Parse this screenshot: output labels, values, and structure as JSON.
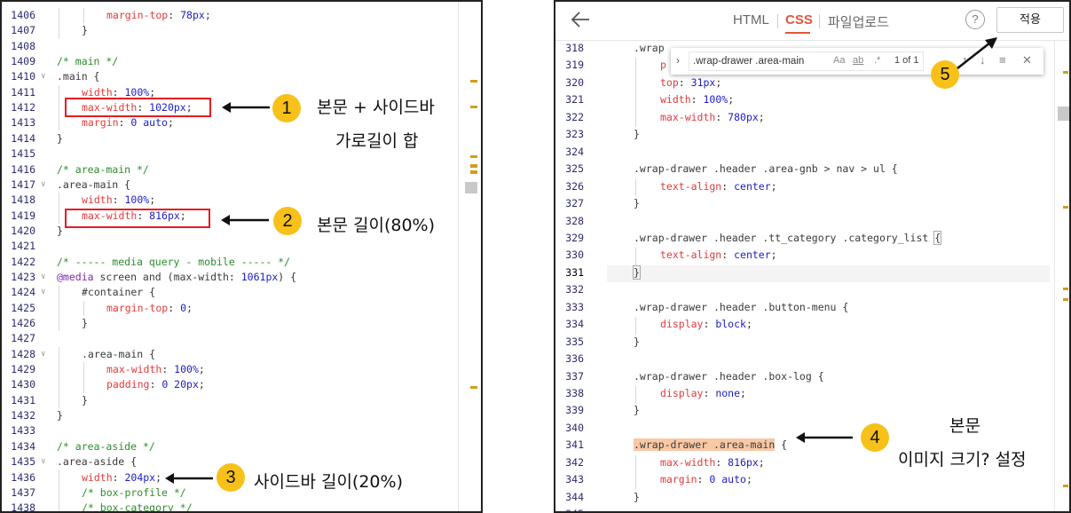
{
  "left_editor": {
    "lines": [
      {
        "n": "1406",
        "indent": 2,
        "fold": "",
        "tokens": [
          [
            "prop",
            "margin-top"
          ],
          [
            "punc",
            ": "
          ],
          [
            "val",
            "78px"
          ],
          [
            "punc",
            ";"
          ]
        ]
      },
      {
        "n": "1407",
        "indent": 1,
        "fold": "",
        "tokens": [
          [
            "punc",
            "}"
          ]
        ]
      },
      {
        "n": "1408",
        "indent": 0,
        "fold": "",
        "tokens": []
      },
      {
        "n": "1409",
        "indent": 0,
        "fold": "",
        "tokens": [
          [
            "cmt",
            "/* main */"
          ]
        ]
      },
      {
        "n": "1410",
        "indent": 0,
        "fold": "∨",
        "tokens": [
          [
            "sel",
            ".main "
          ],
          [
            "punc",
            "{"
          ]
        ]
      },
      {
        "n": "1411",
        "indent": 1,
        "fold": "",
        "tokens": [
          [
            "prop",
            "width"
          ],
          [
            "punc",
            ": "
          ],
          [
            "val",
            "100%"
          ],
          [
            "punc",
            ";"
          ]
        ]
      },
      {
        "n": "1412",
        "indent": 1,
        "fold": "",
        "tokens": [
          [
            "prop",
            "max-width"
          ],
          [
            "punc",
            ": "
          ],
          [
            "val",
            "1020px"
          ],
          [
            "punc",
            ";"
          ]
        ]
      },
      {
        "n": "1413",
        "indent": 1,
        "fold": "",
        "tokens": [
          [
            "prop",
            "margin"
          ],
          [
            "punc",
            ": "
          ],
          [
            "val",
            "0 auto"
          ],
          [
            "punc",
            ";"
          ]
        ]
      },
      {
        "n": "1414",
        "indent": 0,
        "fold": "",
        "tokens": [
          [
            "punc",
            "}"
          ]
        ]
      },
      {
        "n": "1415",
        "indent": 0,
        "fold": "",
        "tokens": []
      },
      {
        "n": "1416",
        "indent": 0,
        "fold": "",
        "tokens": [
          [
            "cmt",
            "/* area-main */"
          ]
        ]
      },
      {
        "n": "1417",
        "indent": 0,
        "fold": "∨",
        "tokens": [
          [
            "sel",
            ".area-main "
          ],
          [
            "punc",
            "{"
          ]
        ]
      },
      {
        "n": "1418",
        "indent": 1,
        "fold": "",
        "tokens": [
          [
            "prop",
            "width"
          ],
          [
            "punc",
            ": "
          ],
          [
            "val",
            "100%"
          ],
          [
            "punc",
            ";"
          ]
        ]
      },
      {
        "n": "1419",
        "indent": 1,
        "fold": "",
        "tokens": [
          [
            "prop",
            "max-width"
          ],
          [
            "punc",
            ": "
          ],
          [
            "val",
            "816px"
          ],
          [
            "punc",
            ";"
          ]
        ]
      },
      {
        "n": "1420",
        "indent": 0,
        "fold": "",
        "tokens": [
          [
            "punc",
            "}"
          ]
        ]
      },
      {
        "n": "1421",
        "indent": 0,
        "fold": "",
        "tokens": []
      },
      {
        "n": "1422",
        "indent": 0,
        "fold": "",
        "tokens": [
          [
            "cmt",
            "/* ----- media query - mobile ----- */"
          ]
        ]
      },
      {
        "n": "1423",
        "indent": 0,
        "fold": "∨",
        "tokens": [
          [
            "kw",
            "@media "
          ],
          [
            "sel",
            "screen and "
          ],
          [
            "punc",
            "("
          ],
          [
            "sel",
            "max-width"
          ],
          [
            "punc",
            ": "
          ],
          [
            "val",
            "1061px"
          ],
          [
            "punc",
            ") {"
          ]
        ]
      },
      {
        "n": "1424",
        "indent": 1,
        "fold": "∨",
        "tokens": [
          [
            "sel",
            "#container "
          ],
          [
            "punc",
            "{"
          ]
        ]
      },
      {
        "n": "1425",
        "indent": 2,
        "fold": "",
        "tokens": [
          [
            "prop",
            "margin-top"
          ],
          [
            "punc",
            ": "
          ],
          [
            "val",
            "0"
          ],
          [
            "punc",
            ";"
          ]
        ]
      },
      {
        "n": "1426",
        "indent": 1,
        "fold": "",
        "tokens": [
          [
            "punc",
            "}"
          ]
        ]
      },
      {
        "n": "1427",
        "indent": 0,
        "fold": "",
        "tokens": []
      },
      {
        "n": "1428",
        "indent": 1,
        "fold": "∨",
        "tokens": [
          [
            "sel",
            ".area-main "
          ],
          [
            "punc",
            "{"
          ]
        ]
      },
      {
        "n": "1429",
        "indent": 2,
        "fold": "",
        "tokens": [
          [
            "prop",
            "max-width"
          ],
          [
            "punc",
            ": "
          ],
          [
            "val",
            "100%"
          ],
          [
            "punc",
            ";"
          ]
        ]
      },
      {
        "n": "1430",
        "indent": 2,
        "fold": "",
        "tokens": [
          [
            "prop",
            "padding"
          ],
          [
            "punc",
            ": "
          ],
          [
            "val",
            "0 20px"
          ],
          [
            "punc",
            ";"
          ]
        ]
      },
      {
        "n": "1431",
        "indent": 1,
        "fold": "",
        "tokens": [
          [
            "punc",
            "}"
          ]
        ]
      },
      {
        "n": "1432",
        "indent": 0,
        "fold": "",
        "tokens": [
          [
            "punc",
            "}"
          ]
        ]
      },
      {
        "n": "1433",
        "indent": 0,
        "fold": "",
        "tokens": []
      },
      {
        "n": "1434",
        "indent": 0,
        "fold": "",
        "tokens": [
          [
            "cmt",
            "/* area-aside */"
          ]
        ]
      },
      {
        "n": "1435",
        "indent": 0,
        "fold": "∨",
        "tokens": [
          [
            "sel",
            ".area-aside "
          ],
          [
            "punc",
            "{"
          ]
        ]
      },
      {
        "n": "1436",
        "indent": 1,
        "fold": "",
        "tokens": [
          [
            "prop",
            "width"
          ],
          [
            "punc",
            ": "
          ],
          [
            "val",
            "204px"
          ],
          [
            "punc",
            ";"
          ]
        ]
      },
      {
        "n": "1437",
        "indent": 1,
        "fold": "",
        "tokens": [
          [
            "cmt",
            "/* box-profile */"
          ]
        ]
      },
      {
        "n": "1438",
        "indent": 1,
        "fold": "",
        "tokens": [
          [
            "cmt",
            "/* box-category */"
          ]
        ]
      }
    ]
  },
  "right_editor": {
    "tabs": {
      "html": "HTML",
      "css": "CSS",
      "file_upload": "파일업로드"
    },
    "help": "?",
    "apply": "적용",
    "find": {
      "query": ".wrap-drawer .area-main",
      "match_case": "Aa",
      "whole_word": "ab",
      "regex": ".*",
      "count": "1 of 1",
      "prev": "↑",
      "next": "↓",
      "in_selection": "≡",
      "close": "✕",
      "toggle": "›"
    },
    "lines": [
      {
        "n": "318",
        "indent": 0,
        "tokens": [
          [
            "sel",
            ".wrap"
          ]
        ]
      },
      {
        "n": "319",
        "indent": 1,
        "tokens": [
          [
            "prop",
            "p"
          ]
        ]
      },
      {
        "n": "320",
        "indent": 1,
        "tokens": [
          [
            "prop",
            "top"
          ],
          [
            "punc",
            ": "
          ],
          [
            "val",
            "31px"
          ],
          [
            "punc",
            ";"
          ]
        ]
      },
      {
        "n": "321",
        "indent": 1,
        "tokens": [
          [
            "prop",
            "width"
          ],
          [
            "punc",
            ": "
          ],
          [
            "val",
            "100%"
          ],
          [
            "punc",
            ";"
          ]
        ]
      },
      {
        "n": "322",
        "indent": 1,
        "tokens": [
          [
            "prop",
            "max-width"
          ],
          [
            "punc",
            ": "
          ],
          [
            "val",
            "780px"
          ],
          [
            "punc",
            ";"
          ]
        ]
      },
      {
        "n": "323",
        "indent": 0,
        "tokens": [
          [
            "punc",
            "}"
          ]
        ]
      },
      {
        "n": "324",
        "indent": 0,
        "tokens": []
      },
      {
        "n": "325",
        "indent": 0,
        "tokens": [
          [
            "sel",
            ".wrap-drawer .header .area-gnb > nav > ul "
          ],
          [
            "punc",
            "{"
          ]
        ]
      },
      {
        "n": "326",
        "indent": 1,
        "tokens": [
          [
            "prop",
            "text-align"
          ],
          [
            "punc",
            ": "
          ],
          [
            "val",
            "center"
          ],
          [
            "punc",
            ";"
          ]
        ]
      },
      {
        "n": "327",
        "indent": 0,
        "tokens": [
          [
            "punc",
            "}"
          ]
        ]
      },
      {
        "n": "328",
        "indent": 0,
        "tokens": []
      },
      {
        "n": "329",
        "indent": 0,
        "tokens": [
          [
            "sel",
            ".wrap-drawer .header .tt_category .category_list "
          ],
          [
            "bracket",
            "{"
          ]
        ]
      },
      {
        "n": "330",
        "indent": 1,
        "tokens": [
          [
            "prop",
            "text-align"
          ],
          [
            "punc",
            ": "
          ],
          [
            "val",
            "center"
          ],
          [
            "punc",
            ";"
          ]
        ]
      },
      {
        "n": "331",
        "indent": 0,
        "tokens": [
          [
            "bracket",
            "}"
          ]
        ],
        "current": true
      },
      {
        "n": "332",
        "indent": 0,
        "tokens": []
      },
      {
        "n": "333",
        "indent": 0,
        "tokens": [
          [
            "sel",
            ".wrap-drawer .header .button-menu "
          ],
          [
            "punc",
            "{"
          ]
        ]
      },
      {
        "n": "334",
        "indent": 1,
        "tokens": [
          [
            "prop",
            "display"
          ],
          [
            "punc",
            ": "
          ],
          [
            "val",
            "block"
          ],
          [
            "punc",
            ";"
          ]
        ]
      },
      {
        "n": "335",
        "indent": 0,
        "tokens": [
          [
            "punc",
            "}"
          ]
        ]
      },
      {
        "n": "336",
        "indent": 0,
        "tokens": []
      },
      {
        "n": "337",
        "indent": 0,
        "tokens": [
          [
            "sel",
            ".wrap-drawer .header .box-log "
          ],
          [
            "punc",
            "{"
          ]
        ]
      },
      {
        "n": "338",
        "indent": 1,
        "tokens": [
          [
            "prop",
            "display"
          ],
          [
            "punc",
            ": "
          ],
          [
            "val",
            "none"
          ],
          [
            "punc",
            ";"
          ]
        ]
      },
      {
        "n": "339",
        "indent": 0,
        "tokens": [
          [
            "punc",
            "}"
          ]
        ]
      },
      {
        "n": "340",
        "indent": 0,
        "tokens": []
      },
      {
        "n": "341",
        "indent": 0,
        "tokens": [
          [
            "hl",
            ".wrap-drawer .area-main"
          ],
          [
            "punc",
            " {"
          ]
        ]
      },
      {
        "n": "342",
        "indent": 1,
        "tokens": [
          [
            "prop",
            "max-width"
          ],
          [
            "punc",
            ": "
          ],
          [
            "val",
            "816px"
          ],
          [
            "punc",
            ";"
          ]
        ]
      },
      {
        "n": "343",
        "indent": 1,
        "tokens": [
          [
            "prop",
            "margin"
          ],
          [
            "punc",
            ": "
          ],
          [
            "val",
            "0 auto"
          ],
          [
            "punc",
            ";"
          ]
        ]
      },
      {
        "n": "344",
        "indent": 0,
        "tokens": [
          [
            "punc",
            "}"
          ]
        ]
      },
      {
        "n": "345",
        "indent": 0,
        "tokens": []
      }
    ]
  },
  "annotations": [
    {
      "num": "1",
      "lines": [
        "본문 + 사이드바",
        "가로길이 합"
      ]
    },
    {
      "num": "2",
      "lines": [
        "본문 길이(80%)"
      ]
    },
    {
      "num": "3",
      "lines": [
        "사이드바 길이(20%)"
      ]
    },
    {
      "num": "4",
      "lines": [
        "본문",
        "이미지 크기? 설정"
      ]
    },
    {
      "num": "5",
      "lines": []
    }
  ],
  "colors": {
    "callout": "#f7c11a",
    "red_box": "#e51c23",
    "active_tab": "#e5533d",
    "highlight": "#f9c8a5"
  }
}
